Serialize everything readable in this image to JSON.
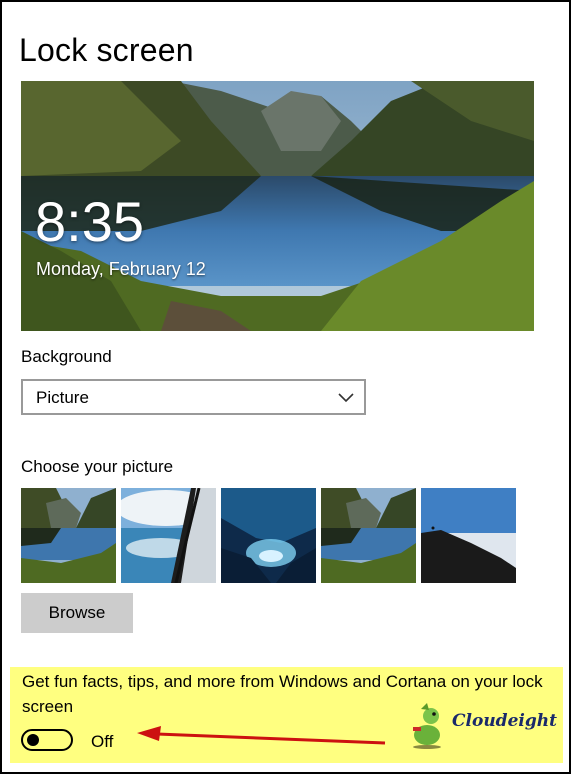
{
  "page": {
    "title": "Lock screen"
  },
  "preview": {
    "time": "8:35",
    "date": "Monday, February 12"
  },
  "background": {
    "label": "Background",
    "selected": "Picture"
  },
  "choose_picture": {
    "label": "Choose your picture",
    "thumbnails": [
      "lake-mountains",
      "ocean-window",
      "ice-cave",
      "lake-mountains",
      "hill-sky"
    ]
  },
  "browse": {
    "label": "Browse"
  },
  "tips": {
    "text": "Get fun facts, tips, and more from Windows and Cortana on your lock screen",
    "toggle_state": "Off",
    "logo": "Cloudeight",
    "highlight_color": "#ffff80",
    "arrow_color": "#cc1111"
  }
}
